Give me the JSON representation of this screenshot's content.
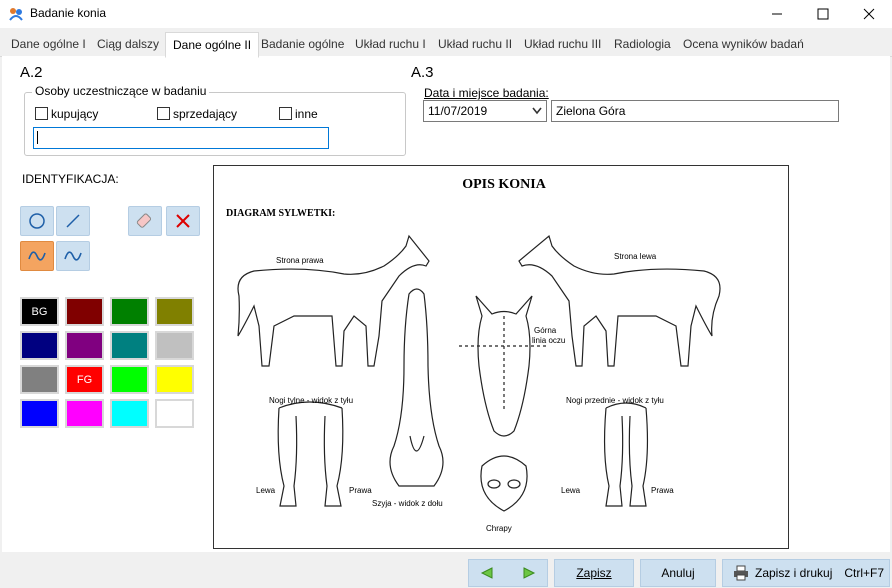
{
  "window": {
    "title": "Badanie konia"
  },
  "tabs": [
    {
      "label": "Dane ogólne I"
    },
    {
      "label": "Ciąg dalszy"
    },
    {
      "label": "Dane ogólne II"
    },
    {
      "label": "Badanie ogólne"
    },
    {
      "label": "Układ ruchu I"
    },
    {
      "label": "Układ ruchu II"
    },
    {
      "label": "Układ ruchu III"
    },
    {
      "label": "Radiologia"
    },
    {
      "label": "Ocena wyników badań"
    }
  ],
  "a2": {
    "heading": "A.2",
    "group_label": "Osoby uczestniczące w badaniu",
    "options": [
      {
        "label": "kupujący"
      },
      {
        "label": "sprzedający"
      },
      {
        "label": "inne"
      }
    ],
    "text_value": ""
  },
  "a3": {
    "heading": "A.3",
    "date_label": "Data i miejsce badania:",
    "date_value": "11/07/2019",
    "place_value": "Zielona Góra"
  },
  "identification": {
    "label": "IDENTYFIKACJA:"
  },
  "palette": {
    "colors": [
      "#000000",
      "#800000",
      "#008000",
      "#808000",
      "#000080",
      "#800080",
      "#008080",
      "#c0c0c0",
      "#808080",
      "#ff0000",
      "#00ff00",
      "#ffff00",
      "#0000ff",
      "#ff00ff",
      "#00ffff",
      "#ffffff"
    ],
    "bg_label": "BG",
    "fg_label": "FG"
  },
  "diagram": {
    "title": "OPIS KONIA",
    "subtitle": "DIAGRAM SYLWETKI:",
    "labels": {
      "right_side": "Strona prawa",
      "left_side": "Strona lewa",
      "eye_line_1": "Górna",
      "eye_line_2": "linia oczu",
      "hind_legs": "Nogi tylne - widok z tyłu",
      "front_legs": "Nogi przednie - widok z tyłu",
      "neck": "Szyja - widok z dołu",
      "nostrils": "Chrapy",
      "left_1": "Lewa",
      "right_1": "Prawa",
      "left_2": "Lewa",
      "right_2": "Prawa"
    }
  },
  "footer": {
    "save": "Zapisz",
    "cancel": "Anuluj",
    "save_print": "Zapisz i drukuj",
    "shortcut": "Ctrl+F7"
  },
  "accent_color": "#0078d7",
  "button_color": "#cde0f0"
}
